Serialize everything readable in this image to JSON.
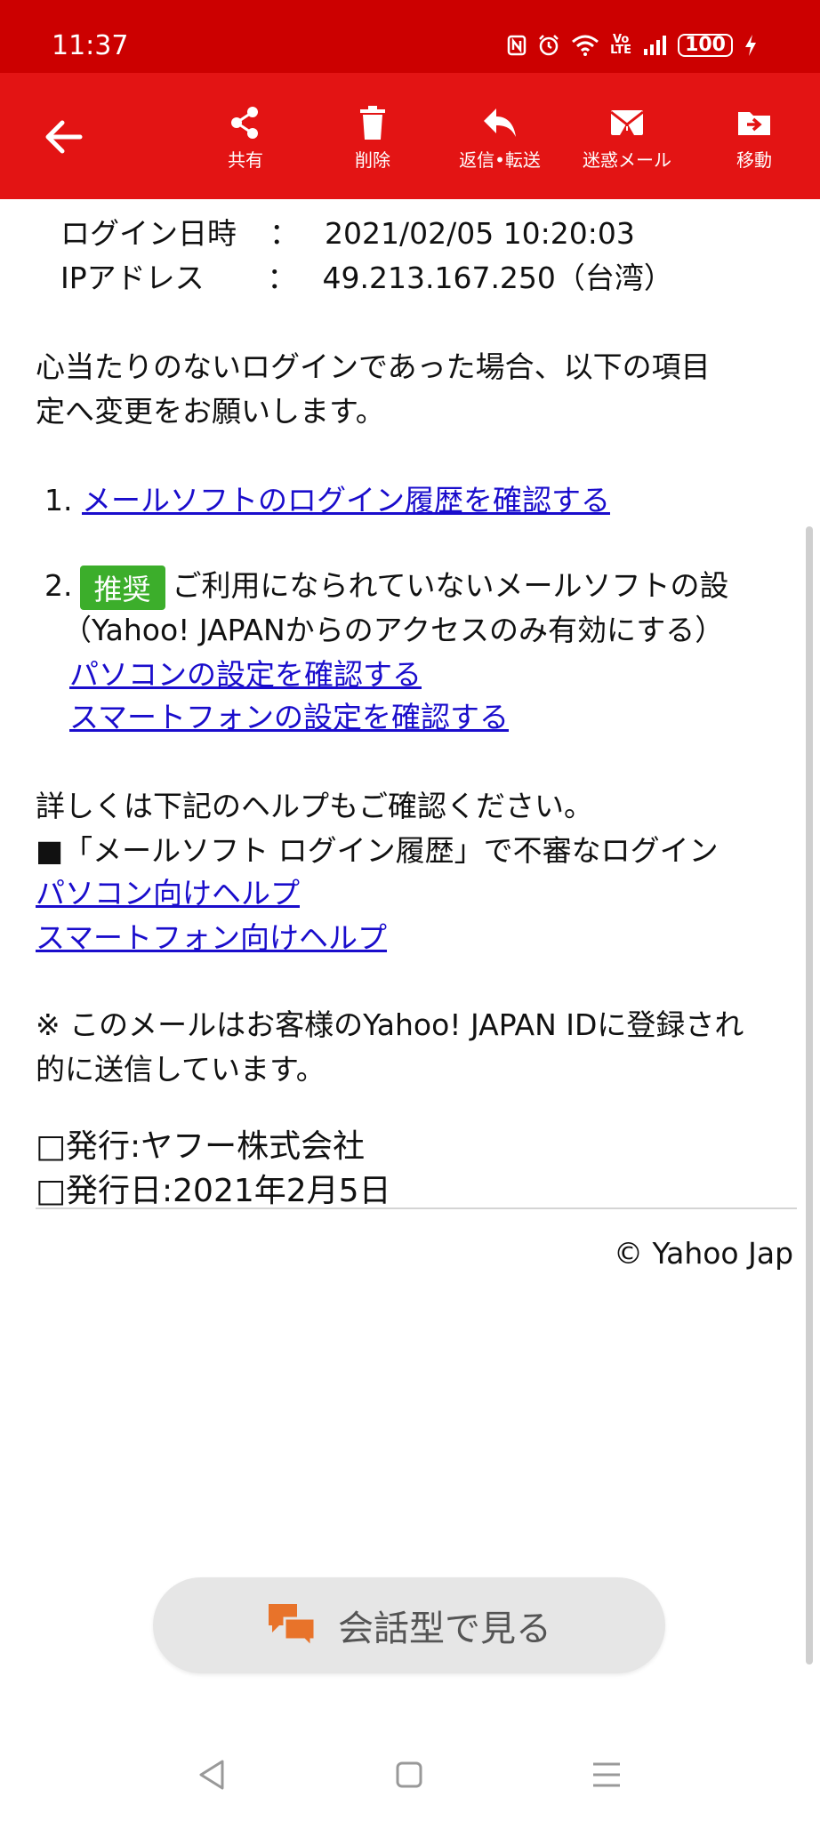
{
  "status_bar": {
    "time": "11:37",
    "battery": "100",
    "icons": [
      "nfc-icon",
      "alarm-icon",
      "wifi-icon",
      "volte-icon",
      "signal-icon",
      "battery-icon",
      "charging-icon"
    ]
  },
  "toolbar": {
    "back_icon": "arrow-left-icon",
    "actions": [
      {
        "label": "共有",
        "icon": "share-icon"
      },
      {
        "label": "削除",
        "icon": "trash-icon"
      },
      {
        "label": "返信•転送",
        "icon": "reply-icon"
      },
      {
        "label": "迷惑メール",
        "icon": "spam-mail-icon"
      },
      {
        "label": "移動",
        "icon": "move-folder-icon"
      }
    ],
    "colors": {
      "toolbar": "#e31414",
      "statusbar": "#cc0000"
    }
  },
  "email": {
    "login_time_label": "ログイン日時",
    "login_time_sep": "：",
    "login_time_value": "2021/02/05 10:20:03",
    "ip_label": "IPアドレス",
    "ip_sep": "：",
    "ip_value": "49.213.167.250（台湾）",
    "notice_line1": "心当たりのないログインであった場合、以下の項目",
    "notice_line2": "定へ変更をお願いします。",
    "item1_num": "1.",
    "item1_link": "メールソフトのログイン履歴を確認する",
    "item2_num": "2.",
    "item2_badge": "推奨",
    "item2_text": "ご利用になられていないメールソフトの設",
    "item2_note": "（Yahoo! JAPANからのアクセスのみ有効にする）",
    "item2_link1": "パソコンの設定を確認する",
    "item2_link2": "スマートフォンの設定を確認する",
    "help_intro": "詳しくは下記のヘルプもご確認ください。",
    "help_heading": "■「メールソフト ログイン履歴」で不審なログイン",
    "help_link_pc": "パソコン向けヘルプ",
    "help_link_sp": "スマートフォン向けヘルプ",
    "footnote_line1": "※ このメールはお客様のYahoo! JAPAN IDに登録され",
    "footnote_line2": "的に送信しています。",
    "publisher": "□発行:ヤフー株式会社",
    "publish_date": "□発行日:2021年2月5日",
    "copyright": "© Yahoo Jap"
  },
  "conversation_button": {
    "label": "会話型で見る",
    "icon": "chat-bubbles-icon",
    "icon_color": "#e8732a"
  },
  "nav_bar": {
    "back_icon": "nav-back-icon",
    "home_icon": "nav-home-icon",
    "menu_icon": "nav-menu-icon"
  }
}
